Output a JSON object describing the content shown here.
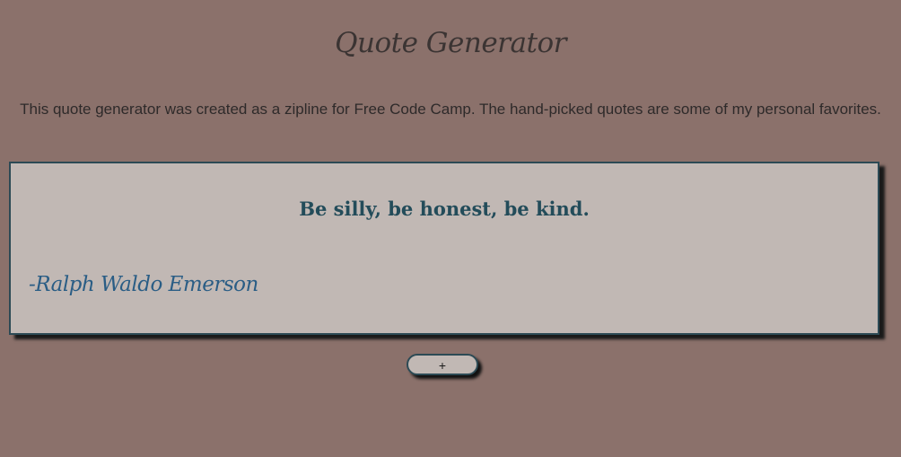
{
  "header": {
    "title": "Quote Generator"
  },
  "intro": {
    "text": "This quote generator was created as a zipline for Free Code Camp. The hand-picked quotes are some of my personal favorites."
  },
  "quote": {
    "text": "Be silly, be honest, be kind.",
    "author": "-Ralph Waldo Emerson"
  },
  "controls": {
    "new_quote_label": "+"
  },
  "colors": {
    "background": "#8b716b",
    "card": "#c1b8b4",
    "border": "#2c4a55",
    "quote_text": "#234c5a",
    "author_text": "#2a5d85"
  }
}
